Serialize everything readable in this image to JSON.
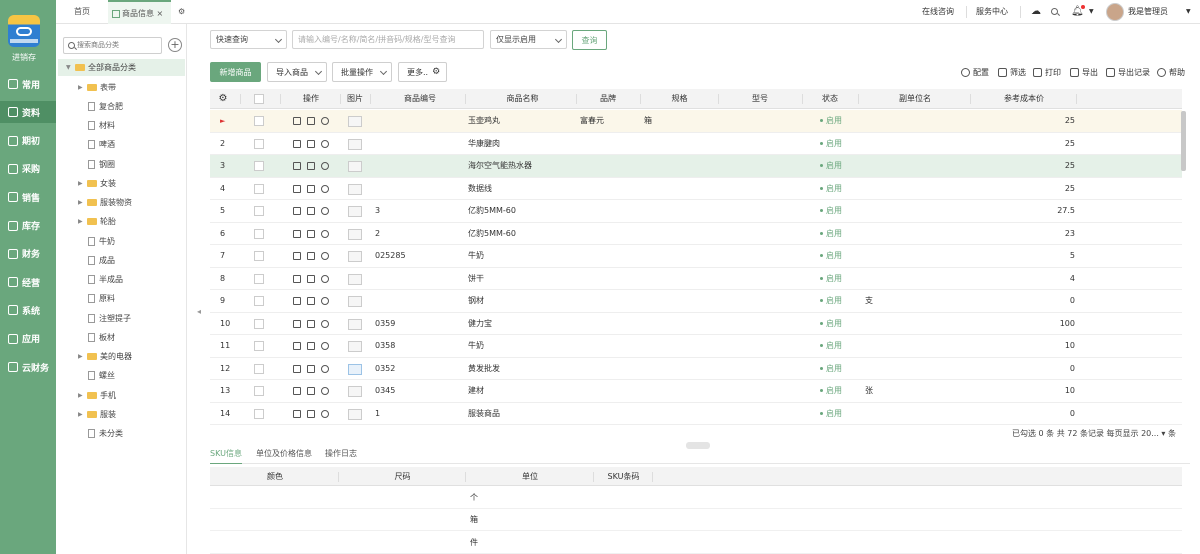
{
  "app": {
    "logo_label": "进销存",
    "brand_color": "#6aa77d"
  },
  "nav": [
    {
      "label": "常用"
    },
    {
      "label": "资料",
      "active": true
    },
    {
      "label": "期初"
    },
    {
      "label": "采购"
    },
    {
      "label": "销售"
    },
    {
      "label": "库存"
    },
    {
      "label": "财务"
    },
    {
      "label": "经营"
    },
    {
      "label": "系统"
    },
    {
      "label": "应用"
    },
    {
      "label": "云财务"
    }
  ],
  "tabs": {
    "home": "首页",
    "active": "商品信息",
    "close": "×"
  },
  "topright": {
    "consult": "在线咨询",
    "service": "服务中心",
    "user": "我是管理员"
  },
  "tree": {
    "search_placeholder": "搜索商品分类",
    "add": "+",
    "root": "全部商品分类",
    "nodes": [
      {
        "label": "表带",
        "folder": true
      },
      {
        "label": "复合肥"
      },
      {
        "label": "材料"
      },
      {
        "label": "啤酒"
      },
      {
        "label": "钢圈"
      },
      {
        "label": "女装",
        "folder": true
      },
      {
        "label": "服装物资",
        "folder": true
      },
      {
        "label": "轮胎",
        "folder": true
      },
      {
        "label": "牛奶"
      },
      {
        "label": "成品"
      },
      {
        "label": "半成品"
      },
      {
        "label": "原料"
      },
      {
        "label": "注塑提子"
      },
      {
        "label": "板材"
      },
      {
        "label": "美的电器",
        "folder": true
      },
      {
        "label": "螺丝"
      },
      {
        "label": "手机",
        "folder": true
      },
      {
        "label": "服装",
        "folder": true
      },
      {
        "label": "未分类"
      }
    ]
  },
  "filters": {
    "quick": "快速查询",
    "search_placeholder": "请输入编号/名称/简名/拼音码/规格/型号查询",
    "enabled": "仅显示启用",
    "query": "查询"
  },
  "toolbar": {
    "new": "新增商品",
    "import": "导入商品",
    "batch": "批量操作",
    "more": "更多..",
    "config": "配置",
    "filter": "筛选",
    "print": "打印",
    "export": "导出",
    "export_log": "导出记录",
    "help": "帮助"
  },
  "columns": {
    "op": "操作",
    "img": "图片",
    "code": "商品编号",
    "name": "商品名称",
    "brand": "品牌",
    "spec": "规格",
    "model": "型号",
    "status": "状态",
    "unit2": "副单位名",
    "cost": "参考成本价"
  },
  "rows": [
    {
      "idx": "►",
      "code": "",
      "name": "玉壶鸡丸",
      "brand": "富春元",
      "spec": "箱",
      "status": "启用",
      "unit2": "",
      "cost": "25"
    },
    {
      "idx": "2",
      "code": "",
      "name": "华康腱肉",
      "brand": "",
      "spec": "",
      "status": "启用",
      "unit2": "",
      "cost": "25"
    },
    {
      "idx": "3",
      "code": "",
      "name": "海尔空气能热水器",
      "brand": "",
      "spec": "",
      "status": "启用",
      "unit2": "",
      "cost": "25"
    },
    {
      "idx": "4",
      "code": "",
      "name": "数据线",
      "brand": "",
      "spec": "",
      "status": "启用",
      "unit2": "",
      "cost": "25"
    },
    {
      "idx": "5",
      "code": "3",
      "name": "亿豹5MM-60",
      "brand": "",
      "spec": "",
      "status": "启用",
      "unit2": "",
      "cost": "27.5"
    },
    {
      "idx": "6",
      "code": "2",
      "name": "亿豹5MM-60",
      "brand": "",
      "spec": "",
      "status": "启用",
      "unit2": "",
      "cost": "23"
    },
    {
      "idx": "7",
      "code": "025285",
      "name": "牛奶",
      "brand": "",
      "spec": "",
      "status": "启用",
      "unit2": "",
      "cost": "5"
    },
    {
      "idx": "8",
      "code": "",
      "name": "饼干",
      "brand": "",
      "spec": "",
      "status": "启用",
      "unit2": "",
      "cost": "4"
    },
    {
      "idx": "9",
      "code": "",
      "name": "钢材",
      "brand": "",
      "spec": "",
      "status": "启用",
      "unit2": "支",
      "cost": "0"
    },
    {
      "idx": "10",
      "code": "0359",
      "name": "健力宝",
      "brand": "",
      "spec": "",
      "status": "启用",
      "unit2": "",
      "cost": "100"
    },
    {
      "idx": "11",
      "code": "0358",
      "name": "牛奶",
      "brand": "",
      "spec": "",
      "status": "启用",
      "unit2": "",
      "cost": "10"
    },
    {
      "idx": "12",
      "code": "0352",
      "name": "黄发批发",
      "brand": "",
      "spec": "",
      "status": "启用",
      "unit2": "",
      "cost": "0"
    },
    {
      "idx": "13",
      "code": "0345",
      "name": "建材",
      "brand": "",
      "spec": "",
      "status": "启用",
      "unit2": "张",
      "cost": "10"
    },
    {
      "idx": "14",
      "code": "1",
      "name": "服装商品",
      "brand": "",
      "spec": "",
      "status": "启用",
      "unit2": "",
      "cost": "0"
    }
  ],
  "pager": {
    "text": "已勾选 0 条 共 72 条记录 每页显示 20... ▾ 条"
  },
  "bottom_tabs": [
    "SKU信息",
    "单位及价格信息",
    "操作日志"
  ],
  "sku_columns": {
    "color": "颜色",
    "size": "尺码",
    "unit": "单位",
    "barcode": "SKU条码"
  },
  "sku_rows": [
    "个",
    "箱",
    "件"
  ]
}
